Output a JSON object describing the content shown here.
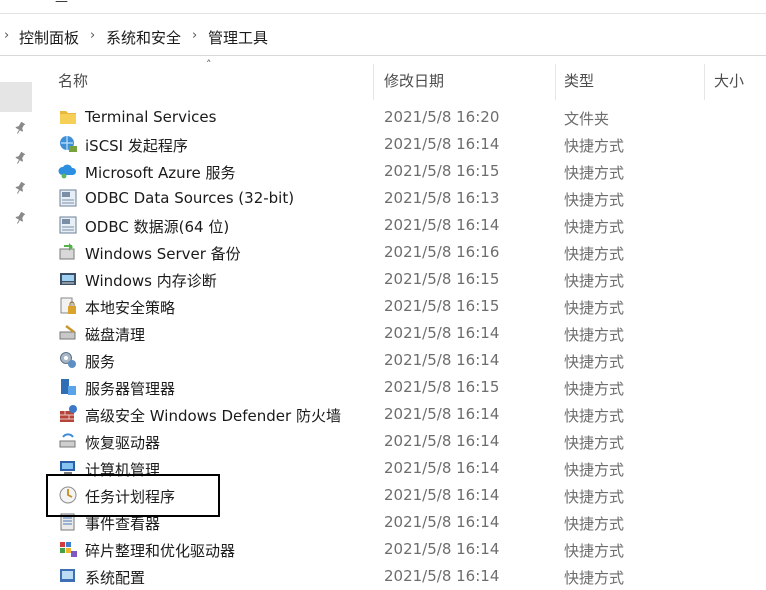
{
  "window": {
    "top_fragments": [
      "ᐩ",
      "—",
      "□"
    ]
  },
  "breadcrumb": {
    "items": [
      "控制面板",
      "系统和安全",
      "管理工具"
    ]
  },
  "columns": {
    "name": "名称",
    "date": "修改日期",
    "type": "类型",
    "size": "大小"
  },
  "files": [
    {
      "name": "Terminal Services",
      "date": "2021/5/8 16:20",
      "type": "文件夹",
      "icon": "folder-icon"
    },
    {
      "name": "iSCSI 发起程序",
      "date": "2021/5/8 16:14",
      "type": "快捷方式",
      "icon": "iscsi-icon"
    },
    {
      "name": "Microsoft Azure 服务",
      "date": "2021/5/8 16:15",
      "type": "快捷方式",
      "icon": "azure-icon"
    },
    {
      "name": "ODBC Data Sources (32-bit)",
      "date": "2021/5/8 16:13",
      "type": "快捷方式",
      "icon": "odbc-icon"
    },
    {
      "name": "ODBC 数据源(64 位)",
      "date": "2021/5/8 16:14",
      "type": "快捷方式",
      "icon": "odbc-icon"
    },
    {
      "name": "Windows Server 备份",
      "date": "2021/5/8 16:16",
      "type": "快捷方式",
      "icon": "backup-icon"
    },
    {
      "name": "Windows 内存诊断",
      "date": "2021/5/8 16:15",
      "type": "快捷方式",
      "icon": "memory-icon"
    },
    {
      "name": "本地安全策略",
      "date": "2021/5/8 16:15",
      "type": "快捷方式",
      "icon": "security-policy-icon"
    },
    {
      "name": "磁盘清理",
      "date": "2021/5/8 16:14",
      "type": "快捷方式",
      "icon": "disk-cleanup-icon"
    },
    {
      "name": "服务",
      "date": "2021/5/8 16:14",
      "type": "快捷方式",
      "icon": "services-icon"
    },
    {
      "name": "服务器管理器",
      "date": "2021/5/8 16:15",
      "type": "快捷方式",
      "icon": "server-manager-icon"
    },
    {
      "name": "高级安全 Windows Defender 防火墙",
      "date": "2021/5/8 16:14",
      "type": "快捷方式",
      "icon": "firewall-icon"
    },
    {
      "name": "恢复驱动器",
      "date": "2021/5/8 16:14",
      "type": "快捷方式",
      "icon": "recovery-drive-icon"
    },
    {
      "name": "计算机管理",
      "date": "2021/5/8 16:14",
      "type": "快捷方式",
      "icon": "computer-management-icon"
    },
    {
      "name": "任务计划程序",
      "date": "2021/5/8 16:14",
      "type": "快捷方式",
      "icon": "task-scheduler-icon"
    },
    {
      "name": "事件查看器",
      "date": "2021/5/8 16:14",
      "type": "快捷方式",
      "icon": "event-viewer-icon"
    },
    {
      "name": "碎片整理和优化驱动器",
      "date": "2021/5/8 16:14",
      "type": "快捷方式",
      "icon": "defrag-icon"
    },
    {
      "name": "系统配置",
      "date": "2021/5/8 16:14",
      "type": "快捷方式",
      "icon": "system-config-icon"
    }
  ]
}
